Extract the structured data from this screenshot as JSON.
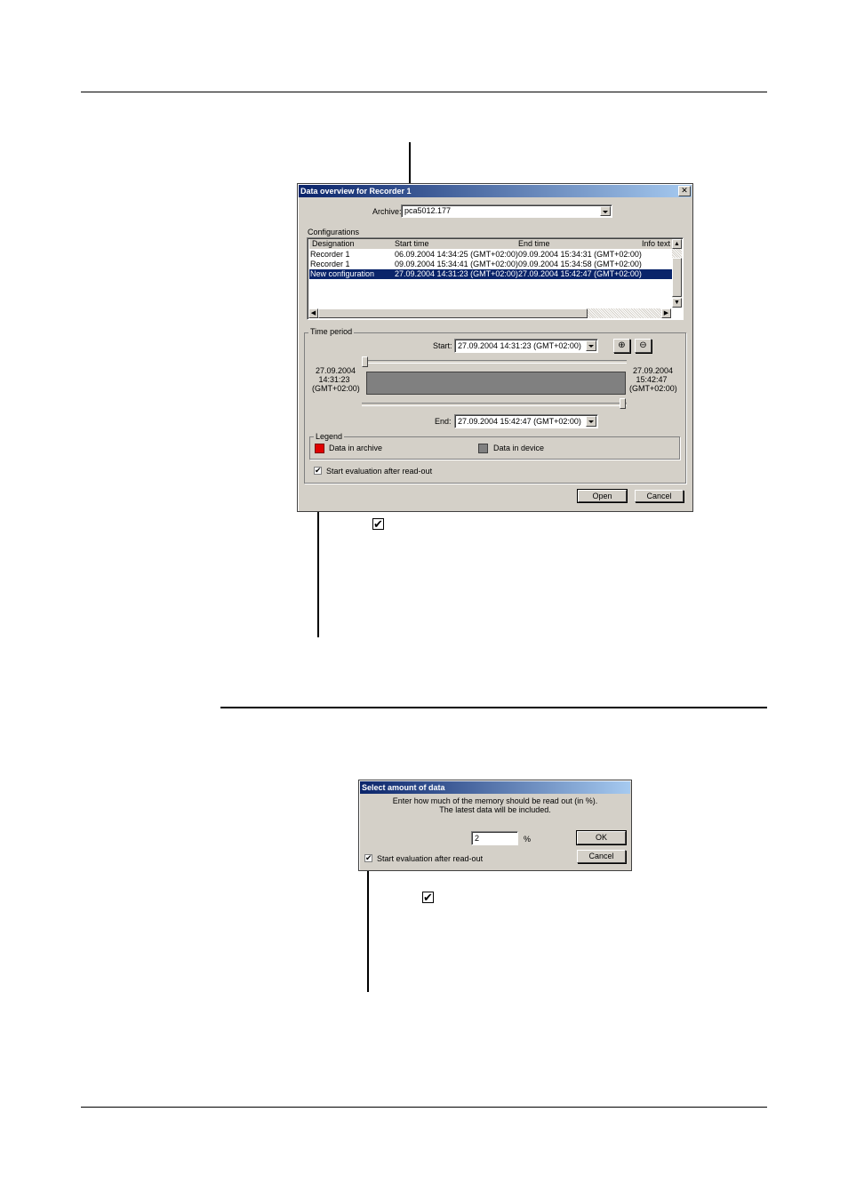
{
  "dialog1": {
    "title": "Data overview for Recorder 1",
    "archive_label": "Archive:",
    "archive_value": "pca5012.177",
    "configurations_label": "Configurations",
    "columns": [
      "Designation",
      "Start time",
      "End time",
      "Info text"
    ],
    "rows": [
      {
        "designation": "Recorder 1",
        "start": "06.09.2004 14:34:25 (GMT+02:00)",
        "end": "09.09.2004 15:34:31 (GMT+02:00)"
      },
      {
        "designation": "Recorder 1",
        "start": "09.09.2004 15:34:41 (GMT+02:00)",
        "end": "09.09.2004 15:34:58 (GMT+02:00)"
      },
      {
        "designation": "New configuration",
        "start": "27.09.2004 14:31:23 (GMT+02:00)",
        "end": "27.09.2004 15:42:47 (GMT+02:00)"
      }
    ],
    "time_period_label": "Time period",
    "start_label": "Start:",
    "start_value": "27.09.2004 14:31:23   (GMT+02:00)",
    "end_label": "End:",
    "end_value": "27.09.2004 15:42:47   (GMT+02:00)",
    "range_left": {
      "date": "27.09.2004",
      "time": "14:31:23",
      "tz": "(GMT+02:00)"
    },
    "range_right": {
      "date": "27.09.2004",
      "time": "15:42:47",
      "tz": "(GMT+02:00)"
    },
    "legend_label": "Legend",
    "legend_archive": "Data in archive",
    "legend_device": "Data in device",
    "start_eval_label": "Start evaluation after read-out",
    "open_button": "Open",
    "cancel_button": "Cancel",
    "colors": {
      "archive": "#e00000",
      "device": "#808080",
      "timeline": "#808080"
    }
  },
  "dialog2": {
    "title": "Select amount of data",
    "message_line1": "Enter how much of the memory should be read out (in %).",
    "message_line2": "The latest data will be included.",
    "percent_value": "2",
    "percent_sign": "%",
    "ok_button": "OK",
    "cancel_button": "Cancel",
    "start_eval_label": "Start evaluation after read-out"
  },
  "check_mark": "✔",
  "icons": {
    "zoom_in": "zoom-in-icon",
    "zoom_out": "zoom-out-icon",
    "checkbox": "checkbox-icon"
  }
}
